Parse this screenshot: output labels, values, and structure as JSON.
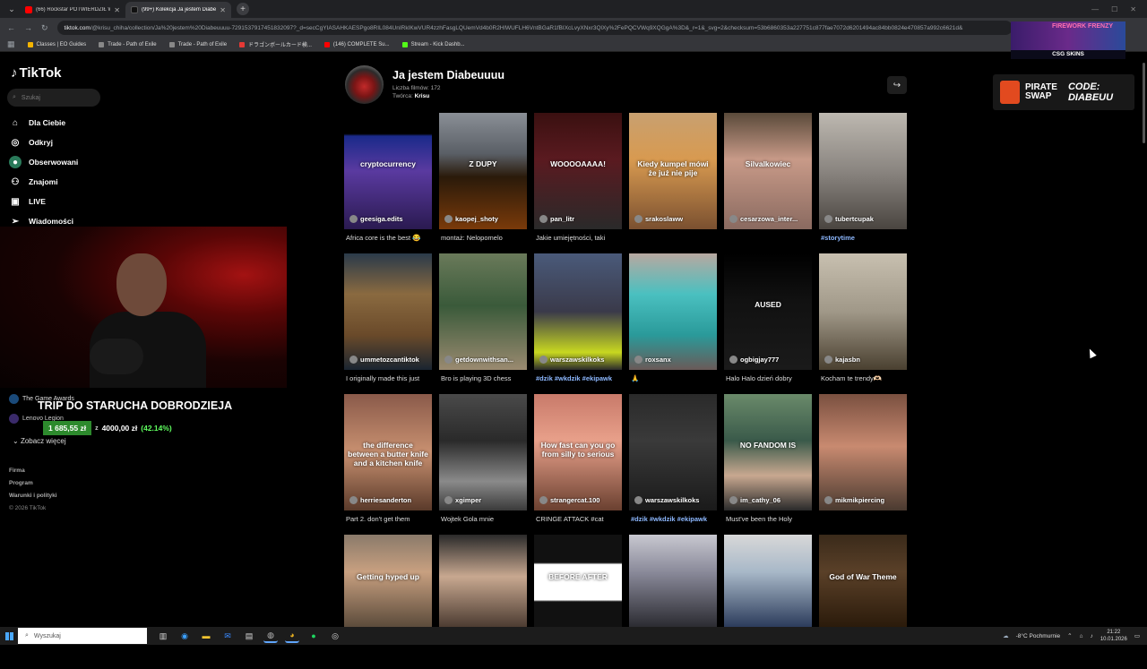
{
  "browser": {
    "tabs": [
      {
        "label": "(66) Rockstar POTWIERDZIŁ W...",
        "color": "#ff0000",
        "active": false
      },
      {
        "label": "(99+) Kolekcja Ja jestem Diabe...",
        "color": "#111111",
        "active": true
      }
    ],
    "url_host": "tiktok.com",
    "url_path": "/@krisu_chiha/collection/Ja%20jestem%20Diabeuuuu-7291537917451832097?_d=secCgYIASAHKAESPgo8RIL084UnIRkIKwVUR4zzhFasgLQUemVd4b0R2HlWUFLH6VntBGaR1fBIXcLvyXNxr3QlXy%2FePQCVWq9XQGgA%3D&_r=1&_svg=2&checksum=53b6860353a227751c877fae7072d6201494ac84bb0824e470857a992c6621d&",
    "bookmarks": [
      {
        "label": "Classes | EO Guides",
        "color": "#f4b400"
      },
      {
        "label": "Trade - Path of Exile",
        "color": "#888888"
      },
      {
        "label": "Trade - Path of Exile",
        "color": "#888888"
      },
      {
        "label": "ドラゴンボールカード検...",
        "color": "#e53935"
      },
      {
        "label": "(146) COMPLETE Su...",
        "color": "#ff0000"
      },
      {
        "label": "Stream - Kick Dashb...",
        "color": "#53fc18"
      }
    ]
  },
  "tiktok": {
    "logo": "TikTok",
    "search_placeholder": "Szukaj",
    "menu": [
      {
        "label": "Dla Ciebie",
        "icon": "home-icon"
      },
      {
        "label": "Odkryj",
        "icon": "compass-icon"
      },
      {
        "label": "Obserwowani",
        "icon": "following-icon"
      },
      {
        "label": "Znajomi",
        "icon": "friends-icon"
      },
      {
        "label": "LIVE",
        "icon": "live-icon"
      },
      {
        "label": "Wiadomości",
        "icon": "messages-icon"
      }
    ],
    "following_1": "The Game Awards",
    "following_2": "Lenovo Legion",
    "see_more": "Zobacz więcej",
    "footer": [
      "Firma",
      "Program",
      "Warunki i polityki"
    ],
    "copyright": "© 2026 TikTok"
  },
  "stream_overlay": {
    "fund_title": "TRIP DO STARUCHA DOBRODZIEJA",
    "fund_current": "1 685,55 zł",
    "fund_separator": "z",
    "fund_goal": "4000,00 zł",
    "fund_percent": "(42.14%)",
    "firework_text": "FIREWORK FRENZY",
    "csg_text": "CSG SKINS",
    "pirate_name_1": "PIRATE",
    "pirate_name_2": "SWAP",
    "code_1": "CODE:",
    "code_2": "DIABEUU"
  },
  "collection": {
    "title": "Ja jestem Diabeuuuu",
    "count_label": "Liczba filmów: 172",
    "creator_prefix": "Twórca:",
    "creator_name": "Krisu"
  },
  "videos": [
    {
      "author": "geesiga.edits",
      "desc": "Africa core is the best 😂",
      "caption": "cryptocurrency",
      "bg": "linear-gradient(180deg,#000 0%,#000 18%,#1a2a8a 20%,#5a3aa0 50%,#2a1a50 100%)",
      "tag": false
    },
    {
      "author": "kaopej_shoty",
      "desc": "montaż: Nelopomelo",
      "caption": "Z DUPY",
      "bg": "linear-gradient(180deg,#8a8f96 0%,#5a5f66 35%,#2a1a0a 55%,#7a3a0a 100%)",
      "tag": false
    },
    {
      "author": "pan_litr",
      "desc": "Jakie umiejętności, taki",
      "caption": "WOOOOAAAA!",
      "bg": "linear-gradient(180deg,#3a1010 0%,#5a1a20 40%,#2a2a2a 100%)",
      "tag": false
    },
    {
      "author": "srakoslaww",
      "desc": "",
      "caption": "Kiedy kumpel mówi że już nie pije",
      "bg": "linear-gradient(180deg,#c8a070 0%,#d89a50 40%,#7a5030 100%)",
      "tag": false
    },
    {
      "author": "cesarzowa_inter...",
      "desc": "",
      "caption": "Silvalkowiec",
      "bg": "linear-gradient(180deg,#5a4a3a 0%,#c89a88 40%,#8a6a60 100%)",
      "tag": false
    },
    {
      "author": "tubertcupak",
      "desc": "#storytime",
      "caption": "",
      "bg": "linear-gradient(180deg,#bdb8b0 0%,#8a8580 50%,#4a4540 100%)",
      "tag": true
    },
    {
      "author": "ummetozcantiktok",
      "desc": "I originally made this just",
      "caption": "",
      "bg": "linear-gradient(180deg,#2a3a4a 0%,#8a6a40 35%,#6a4a2a 70%,#1a2530 100%)",
      "tag": false
    },
    {
      "author": "getdownwithsan...",
      "desc": "Bro is playing 3D chess",
      "caption": "",
      "bg": "linear-gradient(180deg,#6a7a5a 0%,#3a5a3a 45%,#9a8a70 100%)",
      "tag": false
    },
    {
      "author": "warszawskilkoks",
      "desc": "#dzik #wkdzik #ekipawk",
      "caption": "",
      "bg": "linear-gradient(180deg,#4a5a7a 0%,#3a3a4a 50%,#c8d820 85%,#2a2a2a 100%)",
      "tag": true
    },
    {
      "author": "roxsanx",
      "desc": "🙏",
      "caption": "",
      "bg": "linear-gradient(180deg,#b8a8a0 0%,#4ac0c0 35%,#2a9a9a 70%,#6a5a58 100%)",
      "tag": false
    },
    {
      "author": "ogbigjay777",
      "desc": "Halo Halo dzień dobry",
      "caption": "AUSED",
      "bg": "linear-gradient(180deg,#000 0%,#111 40%,#1a1a1a 100%)",
      "tag": false
    },
    {
      "author": "kajasbn",
      "desc": "Kocham te trendy🫶🏻",
      "caption": "",
      "bg": "linear-gradient(180deg,#c8c0b0 0%,#a09888 50%,#4a4030 100%)",
      "tag": false
    },
    {
      "author": "herriesanderton",
      "desc": "Part 2. don't get them",
      "caption": "the difference between a butter knife and a kitchen knife",
      "bg": "linear-gradient(180deg,#8a5a4a 0%,#c89070 50%,#5a3a2a 100%)",
      "tag": false
    },
    {
      "author": "xgimper",
      "desc": "Wojtek Gola mnie",
      "caption": "",
      "bg": "linear-gradient(180deg,#4a4a4a 0%,#2a2a2a 40%,#8a8a8a 75%,#3a3a3a 100%)",
      "tag": false
    },
    {
      "author": "strangercat.100",
      "desc": "CRINGE ATTACK #cat",
      "caption": "How fast can you go from silly to serious",
      "bg": "linear-gradient(180deg,#c87a6a 0%,#e8a08a 40%,#6a4030 100%)",
      "tag": false
    },
    {
      "author": "warszawskilkoks",
      "desc": "#dzik #wkdzik #ekipawk",
      "caption": "",
      "bg": "linear-gradient(180deg,#2a2a2a 0%,#3a3a3a 40%,#1a1a1a 100%)",
      "tag": true
    },
    {
      "author": "im_cathy_06",
      "desc": "Must've been the Holy",
      "caption": "NO FANDOM IS",
      "bg": "linear-gradient(180deg,#6a8a6a 0%,#3a5a4a 40%,#c8a890 70%,#2a2a2a 100%)",
      "tag": false
    },
    {
      "author": "mikmikpiercing",
      "desc": "",
      "caption": "",
      "bg": "linear-gradient(180deg,#7a5040 0%,#c88a70 45%,#4a3a30 100%)",
      "tag": false
    },
    {
      "author": "",
      "desc": "",
      "caption": "Getting hyped up",
      "bg": "linear-gradient(180deg,#8a7a6a 0%,#c8a080 40%,#5a4a3a 100%)",
      "tag": false
    },
    {
      "author": "",
      "desc": "",
      "caption": "",
      "bg": "linear-gradient(180deg,#2a2a2a 0%,#c8a890 45%,#4a3a30 100%)",
      "tag": false
    },
    {
      "author": "",
      "desc": "",
      "caption": "BEFORE AFTER",
      "bg": "linear-gradient(180deg,#111 0%,#111 30%,#fff 32%,#fff 70%,#111 72%)",
      "tag": false
    },
    {
      "author": "",
      "desc": "",
      "caption": "",
      "bg": "linear-gradient(180deg,#c8c8d0 0%,#8a8a9a 40%,#2a2a30 100%)",
      "tag": false
    },
    {
      "author": "",
      "desc": "",
      "caption": "",
      "bg": "linear-gradient(180deg,#d8d8d8 0%,#a8b8c8 40%,#2a3a5a 100%)",
      "tag": false
    },
    {
      "author": "",
      "desc": "",
      "caption": "God of War Theme",
      "bg": "linear-gradient(180deg,#3a2a1a 0%,#5a4028 40%,#2a1a0a 100%)",
      "tag": false
    }
  ],
  "taskbar": {
    "search_placeholder": "Wyszukaj",
    "weather": "-8°C  Pochmurnie",
    "time": "21:22",
    "date": "10.01.2026"
  }
}
